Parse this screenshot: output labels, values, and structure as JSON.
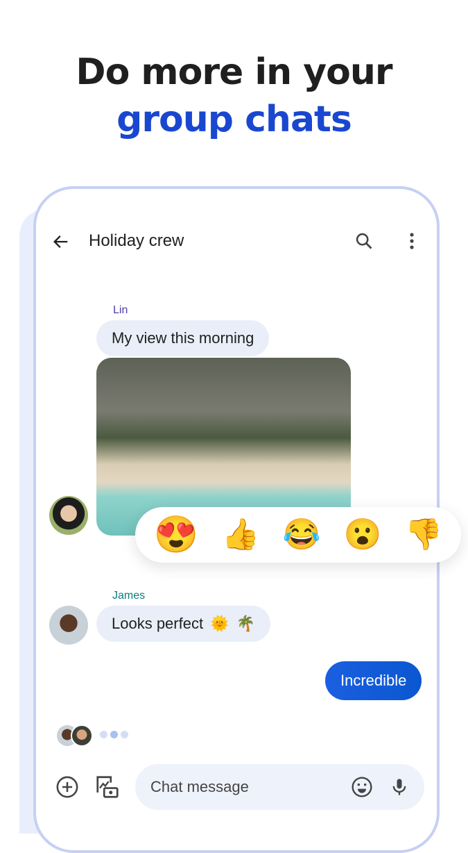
{
  "headline": {
    "line1": "Do more in your",
    "line2": "group chats",
    "accent_color": "#1a47d0"
  },
  "header": {
    "title": "Holiday crew",
    "back_icon": "arrow-left",
    "search_icon": "search",
    "menu_icon": "more-vert"
  },
  "messages": [
    {
      "sender": "Lin",
      "text": "My view this morning",
      "sender_color": "#4b3ea8"
    },
    {
      "sender": "James",
      "text": "Looks perfect",
      "emojis": [
        "🌞",
        "🌴"
      ],
      "sender_color": "#0b7b7b"
    },
    {
      "text": "Incredible",
      "outgoing": true
    }
  ],
  "reactions": [
    "😍",
    "👍",
    "😂",
    "😮",
    "👎"
  ],
  "composer": {
    "placeholder": "Chat message"
  }
}
